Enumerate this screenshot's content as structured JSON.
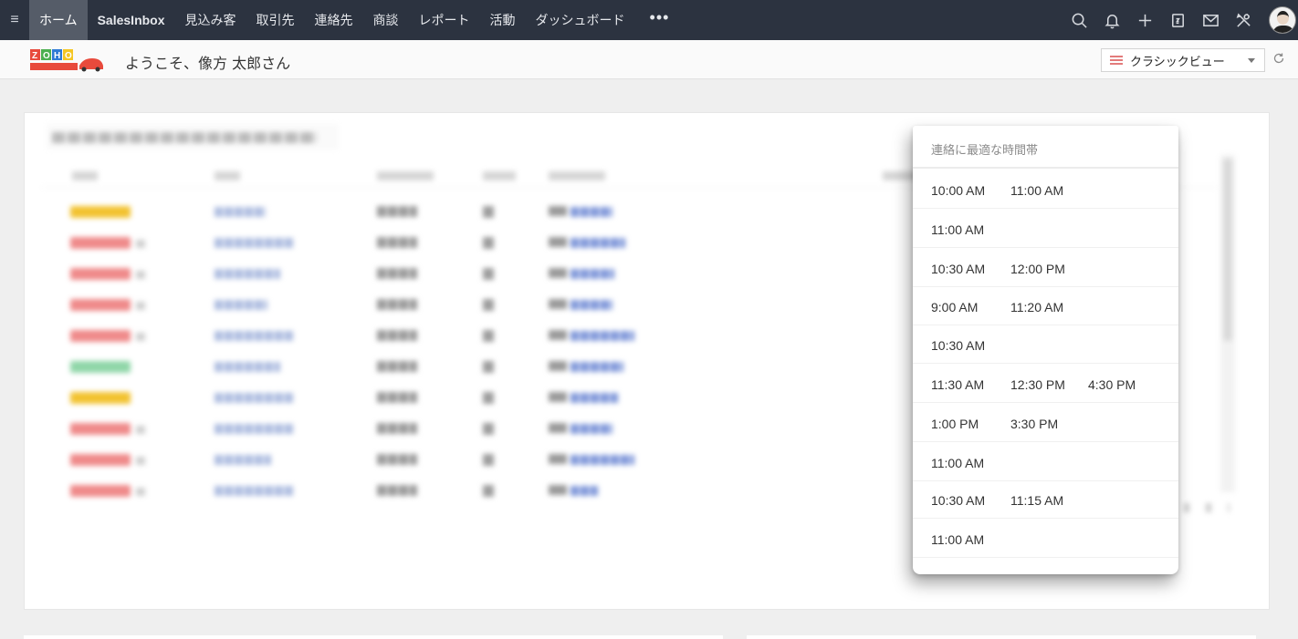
{
  "topnav": {
    "tabs": [
      {
        "label": "ホーム"
      },
      {
        "label": "SalesInbox"
      },
      {
        "label": "見込み客"
      },
      {
        "label": "取引先"
      },
      {
        "label": "連絡先"
      },
      {
        "label": "商談"
      },
      {
        "label": "レポート"
      },
      {
        "label": "活動"
      },
      {
        "label": "ダッシュボード"
      }
    ],
    "more_label": "•••",
    "hamburger": "≡",
    "icons": [
      "search-icon",
      "bell-icon",
      "plus-icon",
      "calendar-icon",
      "mail-icon",
      "tools-icon"
    ]
  },
  "subheader": {
    "welcome": "ようこそ、像方 太郎さん",
    "view_label": "クラシックビュー"
  },
  "popup": {
    "header": "連絡に最適な時間帯",
    "rows": [
      [
        "10:00 AM",
        "11:00 AM"
      ],
      [
        "11:00 AM"
      ],
      [
        "10:30 AM",
        "12:00 PM"
      ],
      [
        "9:00 AM",
        "11:20 AM"
      ],
      [
        "10:30 AM"
      ],
      [
        "11:30 AM",
        "12:30 PM",
        "4:30 PM"
      ],
      [
        "1:00 PM",
        "3:30 PM"
      ],
      [
        "11:00 AM"
      ],
      [
        "10:30 AM",
        "11:15 AM"
      ],
      [
        "11:00 AM"
      ]
    ]
  },
  "table": {
    "status_colors": [
      "#f2c230",
      "#ef8a8a",
      "#ef8a8a",
      "#ef8a8a",
      "#ef8a8a",
      "#8fd6a8",
      "#f2c230",
      "#ef8a8a",
      "#ef8a8a",
      "#ef8a8a"
    ]
  },
  "colors": {
    "nav_bg": "#2c3340",
    "nav_active": "#555c68",
    "link_blue": "#7f97d9"
  }
}
